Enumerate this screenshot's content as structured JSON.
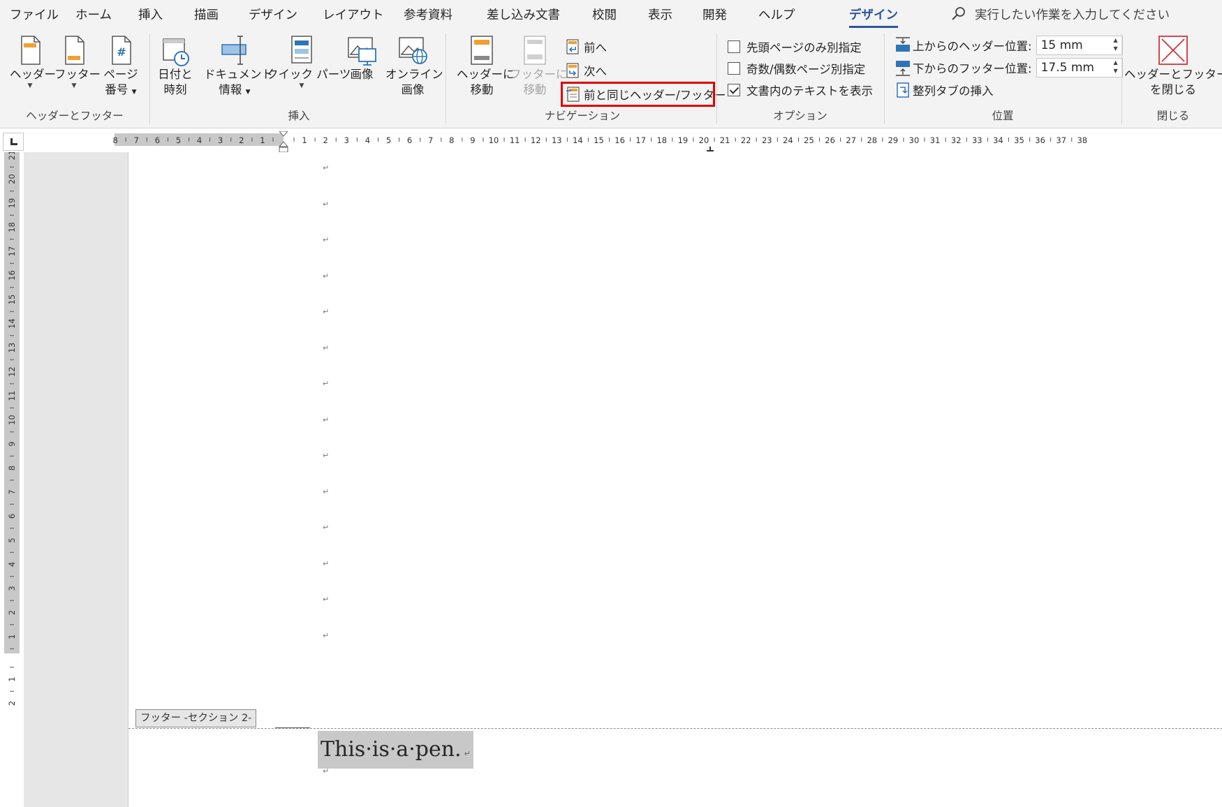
{
  "menu": {
    "tabs": [
      {
        "label": "ファイル"
      },
      {
        "label": "ホーム"
      },
      {
        "label": "挿入"
      },
      {
        "label": "描画"
      },
      {
        "label": "デザイン"
      },
      {
        "label": "レイアウト"
      },
      {
        "label": "参考資料"
      },
      {
        "label": "差し込み文書"
      },
      {
        "label": "校閲"
      },
      {
        "label": "表示"
      },
      {
        "label": "開発"
      },
      {
        "label": "ヘルプ"
      },
      {
        "label": "デザイン",
        "active": true
      }
    ],
    "tell_me": "実行したい作業を入力してください"
  },
  "ribbon": {
    "hf_group": {
      "label": "ヘッダーとフッター",
      "header_btn": "ヘッダー",
      "footer_btn": "フッター",
      "page_number_btn_1": "ページ",
      "page_number_btn_2": "番号"
    },
    "insert_group": {
      "label": "挿入",
      "date_time_1": "日付と",
      "date_time_2": "時刻",
      "doc_info_1": "ドキュメント",
      "doc_info_2": "情報",
      "quick_parts": "クイック パーツ",
      "picture": "画像",
      "online_picture_1": "オンライン",
      "online_picture_2": "画像"
    },
    "nav_group": {
      "label": "ナビゲーション",
      "goto_header_1": "ヘッダーに",
      "goto_header_2": "移動",
      "goto_footer_1": "フッターに",
      "goto_footer_2": "移動",
      "previous": "前へ",
      "next": "次へ",
      "link_to_previous": "前と同じヘッダー/フッター"
    },
    "options_group": {
      "label": "オプション",
      "different_first_page": "先頭ページのみ別指定",
      "different_odd_even": "奇数/偶数ページ別指定",
      "show_document_text": "文書内のテキストを表示"
    },
    "position_group": {
      "label": "位置",
      "header_from_top_label": "上からのヘッダー位置:",
      "header_from_top_value": "15 mm",
      "footer_from_bottom_label": "下からのフッター位置:",
      "footer_from_bottom_value": "17.5 mm",
      "insert_alignment_tab": "整列タブの挿入"
    },
    "close_group": {
      "label": "閉じる",
      "close_btn_1": "ヘッダーとフッター",
      "close_btn_2": "を閉じる"
    }
  },
  "ruler": {
    "left_numbers": [
      "8",
      "7",
      "6",
      "5",
      "4",
      "3",
      "2",
      "1"
    ],
    "right_numbers": [
      "1",
      "2",
      "3",
      "4",
      "5",
      "6",
      "7",
      "8",
      "9",
      "10",
      "11",
      "12",
      "13",
      "14",
      "15",
      "16",
      "17",
      "18",
      "19",
      "20",
      "21",
      "22",
      "23",
      "24",
      "25",
      "26",
      "27",
      "28",
      "29",
      "30",
      "31",
      "32",
      "33",
      "34",
      "35",
      "36",
      "37",
      "38"
    ],
    "vertical_numbers": [
      "21",
      "20",
      "19",
      "18",
      "17",
      "16",
      "15",
      "14",
      "13",
      "12",
      "11",
      "10",
      "9",
      "8",
      "7",
      "6",
      "5",
      "4",
      "3",
      "2",
      "1"
    ],
    "vertical_footer_numbers": [
      "1",
      "2"
    ]
  },
  "document": {
    "paragraph_mark": "↵",
    "footer_tag": "フッター -セクション 2-",
    "footer_text": "This·is·a·pen."
  },
  "colors": {
    "accent": "#2b579a",
    "highlight": "#e00000",
    "icon_orange": "#f0a030",
    "icon_blue": "#2e75b6"
  }
}
